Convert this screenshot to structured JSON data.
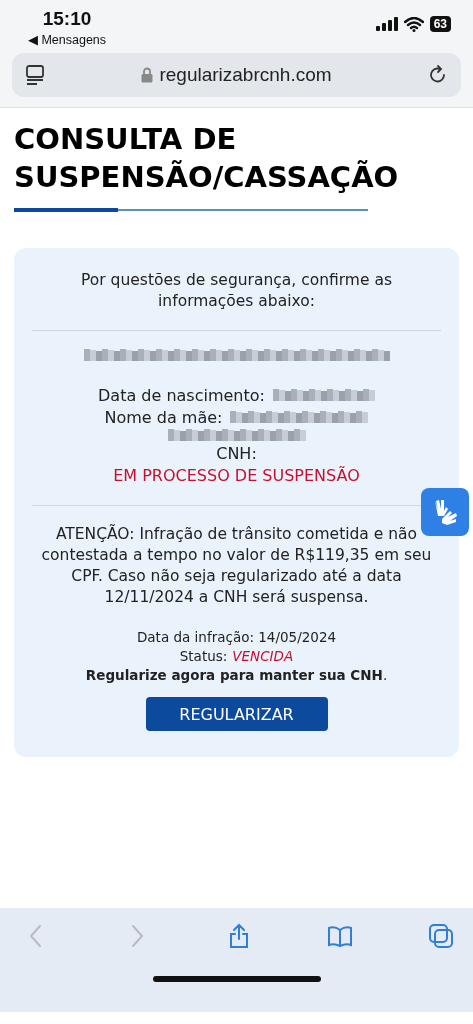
{
  "status_bar": {
    "time": "15:10",
    "back_label": "◀ Mensagens",
    "battery": "63"
  },
  "address_bar": {
    "url": "regularizabrcnh.com"
  },
  "page": {
    "title_lines": [
      "CONSULTA DE",
      "SUSPENSÃO/CASSAÇÃO"
    ],
    "card": {
      "intro": "Por questões de segurança, confirme as informações abaixo:",
      "birth_label": "Data de nascimento:",
      "mother_label": "Nome da mãe:",
      "cnh_label": "CNH:",
      "cnh_status": "EM PROCESSO DE SUSPENSÃO",
      "warning": "ATENÇÃO: Infração de trânsito cometida e não contestada a tempo no valor de R$119,35 em seu CPF. Caso não seja regularizado até a data 12/11/2024 a CNH será suspensa.",
      "infraction_date": "Data da infração: 14/05/2024",
      "status_label": "Status:",
      "status_value": "VENCIDA",
      "call_to_action": "**Regularize agora para manter sua CNH**.",
      "button": "REGULARIZAR"
    }
  },
  "toolbar": [
    {
      "kind": "back",
      "disabled": true
    },
    {
      "kind": "forward",
      "disabled": true
    },
    {
      "kind": "share",
      "disabled": false
    },
    {
      "kind": "bookmarks",
      "disabled": false
    },
    {
      "kind": "tabs",
      "disabled": false
    }
  ]
}
